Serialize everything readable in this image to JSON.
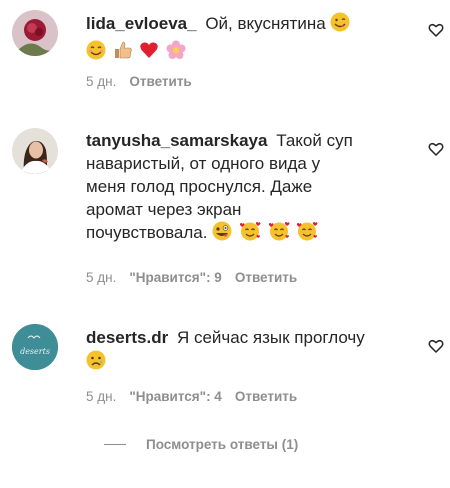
{
  "comments": [
    {
      "username": "lida_evloeva_",
      "text": "Ой, вкуснятина",
      "time": "5 дн.",
      "reply_label": "Ответить",
      "likes_label": "",
      "emoji_inline": [
        "face-savoring-emoji"
      ],
      "emoji_line2": [
        "smiling-face-emoji",
        "thumbs-up-emoji",
        "red-heart-emoji",
        "blossom-emoji"
      ]
    },
    {
      "username": "tanyusha_samarskaya",
      "text_lines": [
        "Такой суп",
        "наваристый, от одного вида у",
        "меня голод проснулся. Даже",
        "аромат через экран",
        "почувствовала."
      ],
      "time": "5 дн.",
      "likes_label": "\"Нравится\": 9",
      "reply_label": "Ответить",
      "emoji_end": [
        "zany-face-emoji",
        "smiling-hearts-emoji",
        "smiling-hearts-emoji",
        "smiling-hearts-emoji"
      ]
    },
    {
      "username": "deserts.dr",
      "text": "Я сейчас язык проглочу",
      "time": "5 дн.",
      "likes_label": "\"Нравится\": 4",
      "reply_label": "Ответить",
      "emoji_line2": [
        "sad-face-emoji"
      ],
      "avatar_text": "deserts"
    }
  ],
  "view_replies": "Посмотреть ответы (1)",
  "colors": {
    "text": "#262626",
    "muted": "#8e8e8e",
    "avatar3": "#3f8d96"
  }
}
